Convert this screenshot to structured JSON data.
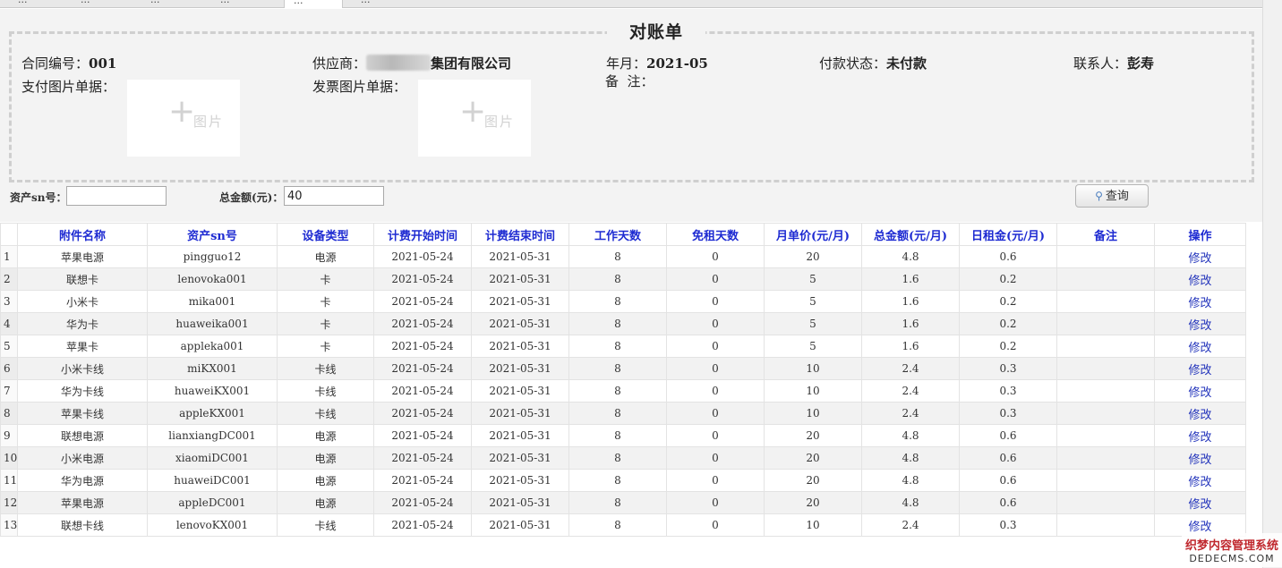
{
  "tabs": [
    {
      "label": "...",
      "active": false
    },
    {
      "label": "...",
      "active": false
    },
    {
      "label": "...",
      "active": false
    },
    {
      "label": "...",
      "active": false
    },
    {
      "label": "...",
      "active": true
    },
    {
      "label": "...",
      "active": false
    }
  ],
  "header": {
    "title": "对账单",
    "contract_label": "合同编号：",
    "contract_value": "001",
    "supplier_label": "供应商：",
    "supplier_value": "集团有限公司",
    "month_label": "年月：",
    "month_value": "2021-05",
    "pay_status_label": "付款状态：",
    "pay_status_value": "未付款",
    "contact_label": "联系人：",
    "contact_value": "彭寿",
    "pay_image_label": "支付图片单据：",
    "invoice_image_label": "发票图片单据：",
    "remark_label": "备  注：",
    "image_placeholder": "图片"
  },
  "filters": {
    "sn_label": "资产sn号：",
    "sn_value": "",
    "total_label": "总金额(元)：",
    "total_value": "40",
    "query_button": "查询"
  },
  "table": {
    "columns": [
      "附件名称",
      "资产sn号",
      "设备类型",
      "计费开始时间",
      "计费结束时间",
      "工作天数",
      "免租天数",
      "月单价(元/月)",
      "总金额(元/月)",
      "日租金(元/月)",
      "备注",
      "操作"
    ],
    "rows": [
      {
        "n": "1",
        "name": "苹果电源",
        "sn": "pingguo12",
        "type": "电源",
        "start": "2021-05-24",
        "end": "2021-05-31",
        "work": "8",
        "free": "0",
        "price": "20",
        "total": "4.8",
        "daily": "0.6",
        "remark": "",
        "op": "修改"
      },
      {
        "n": "2",
        "name": "联想卡",
        "sn": "lenovoka001",
        "type": "卡",
        "start": "2021-05-24",
        "end": "2021-05-31",
        "work": "8",
        "free": "0",
        "price": "5",
        "total": "1.6",
        "daily": "0.2",
        "remark": "",
        "op": "修改"
      },
      {
        "n": "3",
        "name": "小米卡",
        "sn": "mika001",
        "type": "卡",
        "start": "2021-05-24",
        "end": "2021-05-31",
        "work": "8",
        "free": "0",
        "price": "5",
        "total": "1.6",
        "daily": "0.2",
        "remark": "",
        "op": "修改"
      },
      {
        "n": "4",
        "name": "华为卡",
        "sn": "huaweika001",
        "type": "卡",
        "start": "2021-05-24",
        "end": "2021-05-31",
        "work": "8",
        "free": "0",
        "price": "5",
        "total": "1.6",
        "daily": "0.2",
        "remark": "",
        "op": "修改"
      },
      {
        "n": "5",
        "name": "苹果卡",
        "sn": "appleka001",
        "type": "卡",
        "start": "2021-05-24",
        "end": "2021-05-31",
        "work": "8",
        "free": "0",
        "price": "5",
        "total": "1.6",
        "daily": "0.2",
        "remark": "",
        "op": "修改"
      },
      {
        "n": "6",
        "name": "小米卡线",
        "sn": "miKX001",
        "type": "卡线",
        "start": "2021-05-24",
        "end": "2021-05-31",
        "work": "8",
        "free": "0",
        "price": "10",
        "total": "2.4",
        "daily": "0.3",
        "remark": "",
        "op": "修改"
      },
      {
        "n": "7",
        "name": "华为卡线",
        "sn": "huaweiKX001",
        "type": "卡线",
        "start": "2021-05-24",
        "end": "2021-05-31",
        "work": "8",
        "free": "0",
        "price": "10",
        "total": "2.4",
        "daily": "0.3",
        "remark": "",
        "op": "修改"
      },
      {
        "n": "8",
        "name": "苹果卡线",
        "sn": "appleKX001",
        "type": "卡线",
        "start": "2021-05-24",
        "end": "2021-05-31",
        "work": "8",
        "free": "0",
        "price": "10",
        "total": "2.4",
        "daily": "0.3",
        "remark": "",
        "op": "修改"
      },
      {
        "n": "9",
        "name": "联想电源",
        "sn": "lianxiangDC001",
        "type": "电源",
        "start": "2021-05-24",
        "end": "2021-05-31",
        "work": "8",
        "free": "0",
        "price": "20",
        "total": "4.8",
        "daily": "0.6",
        "remark": "",
        "op": "修改"
      },
      {
        "n": "10",
        "name": "小米电源",
        "sn": "xiaomiDC001",
        "type": "电源",
        "start": "2021-05-24",
        "end": "2021-05-31",
        "work": "8",
        "free": "0",
        "price": "20",
        "total": "4.8",
        "daily": "0.6",
        "remark": "",
        "op": "修改"
      },
      {
        "n": "11",
        "name": "华为电源",
        "sn": "huaweiDC001",
        "type": "电源",
        "start": "2021-05-24",
        "end": "2021-05-31",
        "work": "8",
        "free": "0",
        "price": "20",
        "total": "4.8",
        "daily": "0.6",
        "remark": "",
        "op": "修改"
      },
      {
        "n": "12",
        "name": "苹果电源",
        "sn": "appleDC001",
        "type": "电源",
        "start": "2021-05-24",
        "end": "2021-05-31",
        "work": "8",
        "free": "0",
        "price": "20",
        "total": "4.8",
        "daily": "0.6",
        "remark": "",
        "op": "修改"
      },
      {
        "n": "13",
        "name": "联想卡线",
        "sn": "lenovoKX001",
        "type": "卡线",
        "start": "2021-05-24",
        "end": "2021-05-31",
        "work": "8",
        "free": "0",
        "price": "10",
        "total": "2.4",
        "daily": "0.3",
        "remark": "",
        "op": "修改"
      }
    ]
  },
  "watermark": {
    "line1": "织梦内容管理系统",
    "line2": "DEDECMS.COM"
  },
  "icons": {
    "query": "search-icon",
    "image_upload": "plus-icon"
  },
  "colors": {
    "header_text": "#1e2bd2",
    "link": "#2233bb",
    "panel_bg": "#f3f3f3"
  }
}
